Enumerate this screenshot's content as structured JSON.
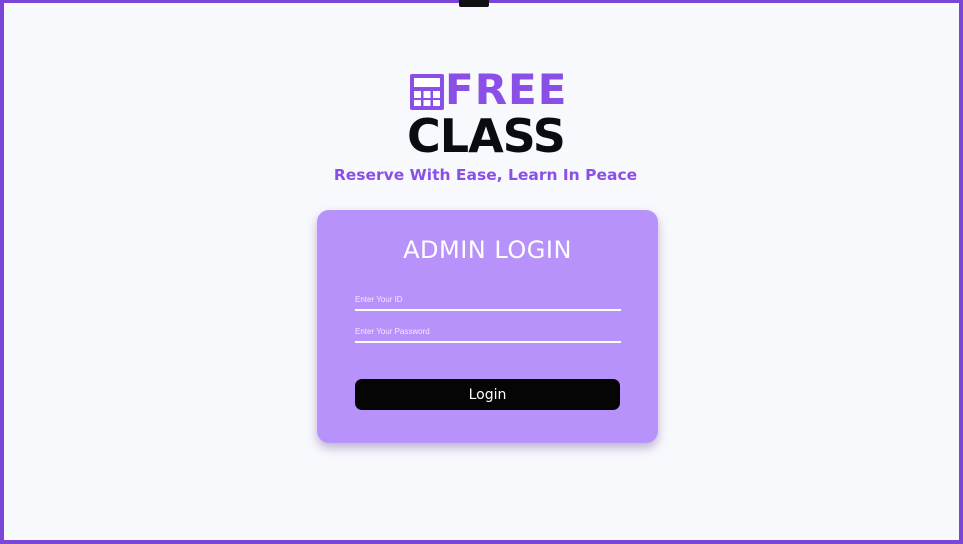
{
  "brand": {
    "logo_free": "FREE",
    "logo_class": "CLASS",
    "tagline": "Reserve With Ease, Learn In Peace",
    "accent_color": "#8a4fe6",
    "icon": "calendar-grid-icon"
  },
  "login_card": {
    "title": "ADMIN LOGIN",
    "id_placeholder": "Enter Your ID",
    "password_placeholder": "Enter Your Password",
    "login_label": "Login",
    "card_color": "#b792fb",
    "button_color": "#050505"
  }
}
